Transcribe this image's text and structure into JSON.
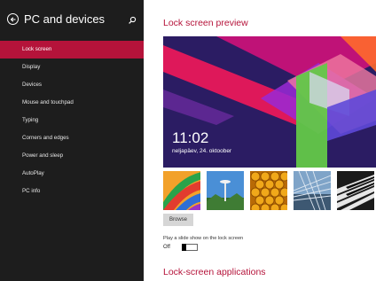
{
  "sidebar": {
    "title": "PC and devices",
    "back_icon": "back-arrow-icon",
    "search_icon": "search-icon",
    "items": [
      {
        "label": "Lock screen",
        "active": true
      },
      {
        "label": "Display",
        "active": false
      },
      {
        "label": "Devices",
        "active": false
      },
      {
        "label": "Mouse and touchpad",
        "active": false
      },
      {
        "label": "Typing",
        "active": false
      },
      {
        "label": "Corners and edges",
        "active": false
      },
      {
        "label": "Power and sleep",
        "active": false
      },
      {
        "label": "AutoPlay",
        "active": false
      },
      {
        "label": "PC info",
        "active": false
      }
    ]
  },
  "main": {
    "preview_title": "Lock screen preview",
    "preview": {
      "time": "11:02",
      "date": "neljapäev, 24. oktoober"
    },
    "thumbnails": [
      "thumbnail-colorful-curves",
      "thumbnail-space-needle",
      "thumbnail-honeycomb",
      "thumbnail-bridge",
      "thumbnail-piano-keys"
    ],
    "browse_label": "Browse",
    "slideshow_label": "Play a slide show on the lock screen",
    "slideshow_state": "Off",
    "section_title": "Lock-screen applications"
  },
  "colors": {
    "accent": "#b5133a",
    "sidebar_bg": "#1d1d1d",
    "preview_bg": "#2b1c63"
  }
}
